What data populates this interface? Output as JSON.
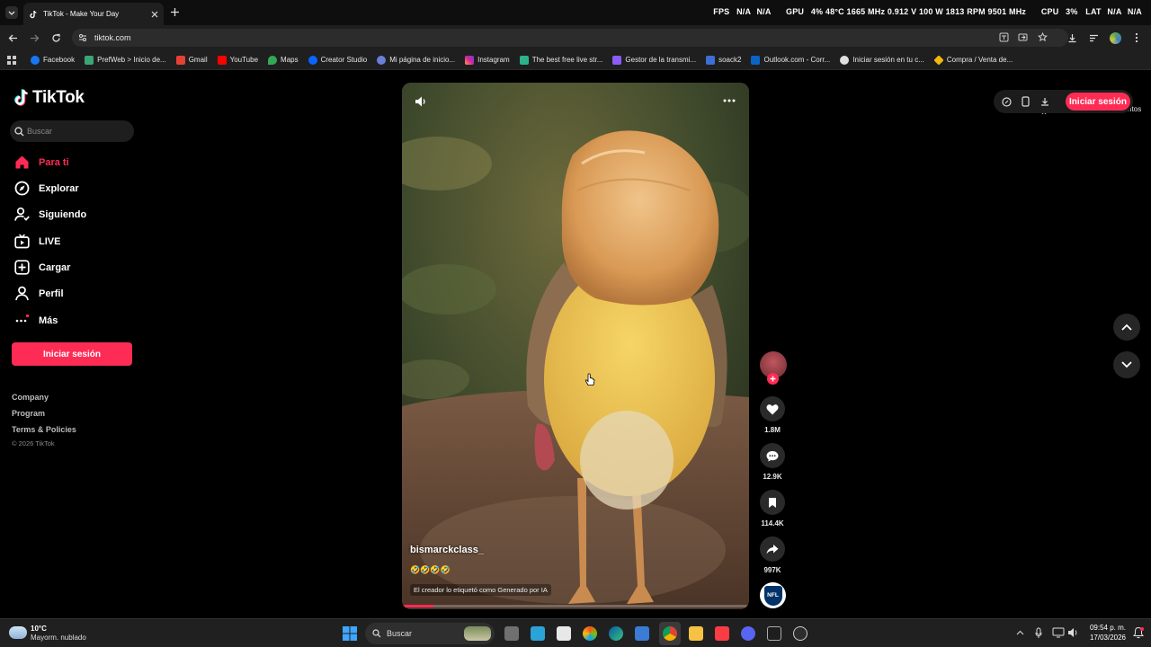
{
  "browser": {
    "tab_title": "TikTok - Make Your Day",
    "url": "tiktok.com",
    "bookmarks": [
      "Facebook",
      "PrefWeb > Inicio de...",
      "Gmail",
      "YouTube",
      "Maps",
      "Creator Studio",
      "Mi página de inicio...",
      "Instagram",
      "The best free live str...",
      "Gestor de la transmi...",
      "soack2",
      "Outlook.com - Corr...",
      "Iniciar sesión en tu c...",
      "Compra / Venta de..."
    ],
    "bookmarks_folder": "Todos los favoritos",
    "colors": {
      "tab_bg": "#1f1f1f",
      "toolbar_bg": "#1f1f1f"
    }
  },
  "overlay": {
    "fps_label": "FPS",
    "fps_value": "N/A",
    "fps_value2": "N/A",
    "gpu_label": "GPU",
    "gpu_stats": "4% 48°C 1665 MHz 0.912 V 100 W 1813 RPM 9501 MHz",
    "cpu_label": "CPU",
    "cpu_stats": "3%",
    "lat_label": "LAT",
    "lat_value": "N/A",
    "lat_value2": "N/A"
  },
  "sidebar": {
    "logo": "TikTok",
    "search_placeholder": "Buscar",
    "items": [
      {
        "label": "Para ti",
        "icon": "home-icon",
        "active": true
      },
      {
        "label": "Explorar",
        "icon": "compass-icon"
      },
      {
        "label": "Siguiendo",
        "icon": "following-icon"
      },
      {
        "label": "LIVE",
        "icon": "live-icon"
      },
      {
        "label": "Cargar",
        "icon": "upload-icon"
      },
      {
        "label": "Perfil",
        "icon": "profile-icon"
      },
      {
        "label": "Más",
        "icon": "more-icon"
      }
    ],
    "login_button": "Iniciar sesión",
    "footer_links": [
      "Company",
      "Program",
      "Terms & Policies"
    ],
    "copyright": "© 2026 TikTok",
    "accent": "#fe2c55"
  },
  "header": {
    "login_button": "Iniciar sesión"
  },
  "video": {
    "author": "bismarckclass_",
    "caption_emojis": "🤣🤣🤣🤣",
    "ai_label": "El creador lo etiquetó como Generado por IA",
    "progress": 0.09
  },
  "actions": {
    "likes": "1.8M",
    "comments": "12.9K",
    "saves": "114.4K",
    "shares": "997K",
    "music_badge": "NFL"
  },
  "taskbar": {
    "weather_temp": "10°C",
    "weather_desc": "Mayorm. nublado",
    "search_placeholder": "Buscar",
    "time": "09:54 p. m.",
    "date": "17/03/2026"
  }
}
